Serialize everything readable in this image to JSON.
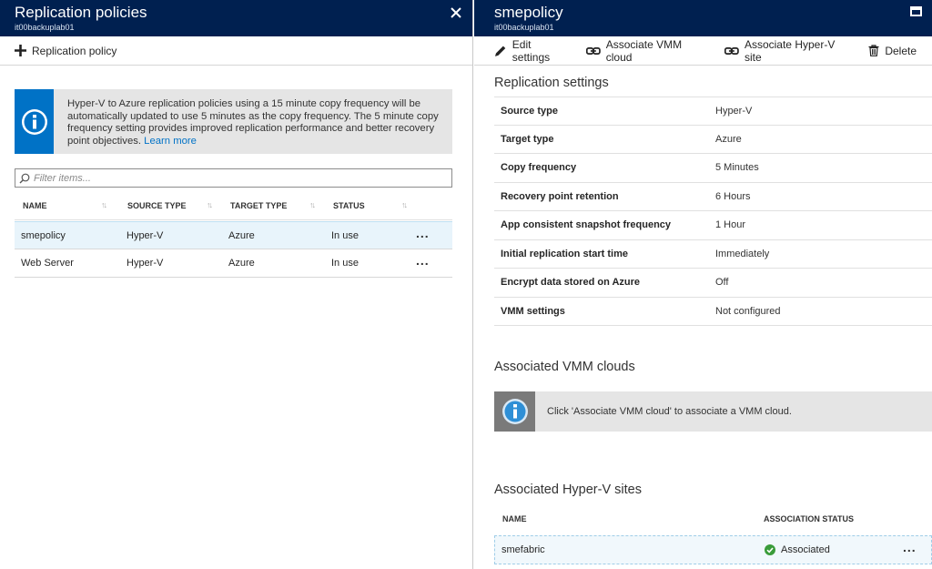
{
  "left_blade": {
    "title": "Replication policies",
    "subtitle": "it00backuplab01",
    "add_label": "Replication policy",
    "info_text": "Hyper-V to Azure replication policies using a 15 minute copy frequency will be automatically updated to use 5 minutes as the copy frequency. The 5 minute copy frequency setting provides improved replication performance and better recovery point objectives.",
    "info_link": "Learn more",
    "filter_placeholder": "Filter items...",
    "columns": [
      "NAME",
      "SOURCE TYPE",
      "TARGET TYPE",
      "STATUS"
    ],
    "rows": [
      {
        "name": "smepolicy",
        "source": "Hyper-V",
        "target": "Azure",
        "status": "In use",
        "more": "..."
      },
      {
        "name": "Web Server",
        "source": "Hyper-V",
        "target": "Azure",
        "status": "In use",
        "more": "..."
      }
    ]
  },
  "right_blade": {
    "title": "smepolicy",
    "subtitle": "it00backuplab01",
    "commands": {
      "edit": "Edit settings",
      "assoc_vmm": "Associate VMM cloud",
      "assoc_hv": "Associate Hyper-V site",
      "delete": "Delete"
    },
    "replication_title": "Replication settings",
    "properties": [
      {
        "key": "Source type",
        "value": "Hyper-V"
      },
      {
        "key": "Target type",
        "value": "Azure"
      },
      {
        "key": "Copy frequency",
        "value": "5 Minutes"
      },
      {
        "key": "Recovery point retention",
        "value": "6 Hours"
      },
      {
        "key": "App consistent snapshot frequency",
        "value": "1 Hour"
      },
      {
        "key": "Initial replication start time",
        "value": "Immediately"
      },
      {
        "key": "Encrypt data stored on Azure",
        "value": "Off"
      },
      {
        "key": "VMM settings",
        "value": "Not configured"
      }
    ],
    "vmm_title": "Associated VMM clouds",
    "vmm_info": "Click 'Associate VMM cloud' to associate a VMM cloud.",
    "hv_title": "Associated Hyper-V sites",
    "hv_columns": [
      "NAME",
      "ASSOCIATION STATUS"
    ],
    "hv_rows": [
      {
        "name": "smefabric",
        "status": "Associated",
        "more": "..."
      }
    ]
  },
  "colors": {
    "header": "#002050",
    "accent": "#0072c6",
    "success": "#3a9c3a"
  },
  "icons": [
    "close-icon",
    "maximize-icon",
    "plus-icon",
    "info-icon",
    "search-icon",
    "sort-icon",
    "pencil-icon",
    "link-icon",
    "trash-icon",
    "check-circle-icon",
    "more-icon"
  ]
}
